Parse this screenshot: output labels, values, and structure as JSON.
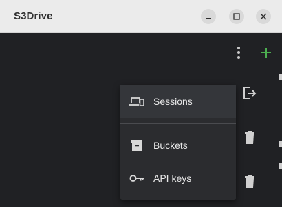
{
  "window": {
    "title": "S3Drive",
    "controls": [
      "minimize-icon",
      "maximize-icon",
      "close-icon"
    ]
  },
  "toolbar": {
    "icons": [
      "more-vert-icon",
      "add-icon"
    ],
    "add_color": "#4caf50"
  },
  "menu": {
    "items": [
      {
        "label": "Sessions",
        "icon": "devices-icon",
        "highlighted": true
      },
      {
        "label": "Buckets",
        "icon": "archive-icon",
        "highlighted": false
      },
      {
        "label": "API keys",
        "icon": "key-icon",
        "highlighted": false
      }
    ]
  },
  "background_rows": {
    "icons": [
      "logout-icon",
      "trash-icon",
      "trash-icon"
    ]
  },
  "colors": {
    "background": "#202124",
    "menu": "#2b2c2f",
    "accent": "#4caf50",
    "titlebar": "#ebebeb"
  }
}
